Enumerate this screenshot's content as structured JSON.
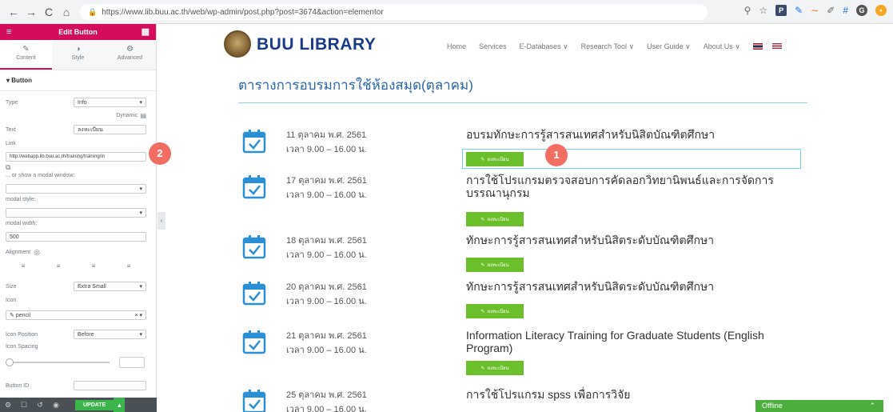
{
  "browser": {
    "url": "https://www.lib.buu.ac.th/web/wp-admin/post.php?post=3674&action=elementor",
    "back": "←",
    "forward": "→",
    "reload": "C",
    "home": "⌂"
  },
  "editor": {
    "title": "Edit Button",
    "tabs": [
      {
        "label": "Content",
        "icon": "✎"
      },
      {
        "label": "Style",
        "icon": "◑"
      },
      {
        "label": "Advanced",
        "icon": "⚙"
      }
    ],
    "section": "Button",
    "type_label": "Type",
    "type_value": "Info",
    "dynamic_label": "Dynamic",
    "text_label": "Text",
    "text_value": "ลงทะเบียน",
    "link_label": "Link",
    "link_value": "http://webapp.lib.buu.ac.th/training/training/in",
    "modal_label": "... or show a modal window:",
    "modal_style_label": "modal style:",
    "modal_width_label": "modal width:",
    "modal_width_value": "500",
    "alignment_label": "Alignment",
    "size_label": "Size",
    "size_value": "Extra Small",
    "icon_label": "Icon",
    "icon_value": "pencil",
    "icon_position_label": "Icon Position",
    "icon_position_value": "Before",
    "icon_spacing_label": "Icon Spacing",
    "button_id_label": "Button ID",
    "update_label": "UPDATE"
  },
  "site": {
    "logo_text": "BUU LIBRARY",
    "nav": [
      "Home",
      "Services",
      "E-Databases ∨",
      "Research Tool ∨",
      "User Guide ∨",
      "About Us ∨"
    ],
    "page_title": "ตารางการอบรมการใช้ห้องสมุด(ตุลาคม)",
    "register_label": "ลงทะเบียน",
    "events": [
      {
        "date": "11 ตุลาคม พ.ศ. 2561",
        "time": "เวลา 9.00 – 16.00 น.",
        "title": "อบรมทักษะการรู้สารสนเทศสำหรับนิสิตบัณฑิตศึกษา"
      },
      {
        "date": "17 ตุลาคม พ.ศ. 2561",
        "time": "เวลา 9.00 – 16.00 น.",
        "title": "การใช้โปรแกรมตรวจสอบการคัดลอกวิทยานิพนธ์และการจัดการบรรณานุกรม"
      },
      {
        "date": "18 ตุลาคม พ.ศ. 2561",
        "time": "เวลา 9.00 – 16.00 น.",
        "title": "ทักษะการรู้สารสนเทศสำหรับนิสิตระดับบัณฑิตศึกษา"
      },
      {
        "date": "20 ตุลาคม พ.ศ. 2561",
        "time": "เวลา 9.00 – 16.00 น.",
        "title": "ทักษะการรู้สารสนเทศสำหรับนิสิตระดับบัณฑิตศึกษา"
      },
      {
        "date": "21 ตุลาคม พ.ศ. 2561",
        "time": "เวลา 9.00 – 16.00 น.",
        "title": "Information Literacy Training for Graduate Students (English Program)"
      },
      {
        "date": "25 ตุลาคม พ.ศ. 2561",
        "time": "เวลา 9.00 – 16.00 น.",
        "title": "การใช้โปรแกรม spss เพื่อการวิจัย"
      }
    ]
  },
  "badges": {
    "one": "1",
    "two": "2"
  },
  "chat": {
    "status": "Offline"
  },
  "colors": {
    "accent": "#d30c5c",
    "link_blue": "#2a66b0",
    "button_green": "#6bbf2a",
    "badge_red": "#f26d62"
  }
}
